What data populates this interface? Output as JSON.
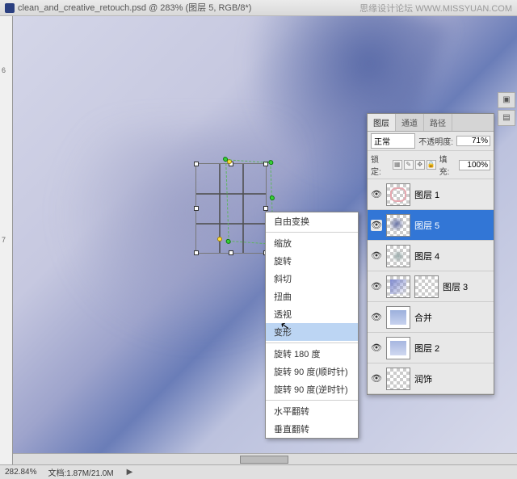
{
  "watermark": "思缘设计论坛   WWW.MISSYUAN.COM",
  "title": {
    "filename": "clean_and_creative_retouch.psd",
    "zoom": "283%",
    "layer_info": "(图层 5, RGB/8*)"
  },
  "ruler": {
    "mark6": "6",
    "mark7": "7"
  },
  "context_menu": {
    "free_transform": "自由变换",
    "scale": "缩放",
    "rotate": "旋转",
    "skew": "斜切",
    "distort": "扭曲",
    "perspective": "透视",
    "warp": "变形",
    "rotate180": "旋转 180 度",
    "rotate90cw": "旋转 90 度(顺时针)",
    "rotate90ccw": "旋转 90 度(逆时针)",
    "flip_h": "水平翻转",
    "flip_v": "垂直翻转"
  },
  "layers_panel": {
    "tab_layers": "图层",
    "tab_channels": "通道",
    "tab_paths": "路径",
    "blend_mode": "正常",
    "opacity_label": "不透明度:",
    "opacity_value": "71%",
    "lock_label": "锁定:",
    "fill_label": "填充:",
    "fill_value": "100%",
    "layers": [
      {
        "name": "图层 1",
        "selected": false,
        "thumb": "pink-outline"
      },
      {
        "name": "图层 5",
        "selected": true,
        "thumb": "blue-smudge"
      },
      {
        "name": "图层 4",
        "selected": false,
        "thumb": "gray-smudge"
      },
      {
        "name": "图层 3",
        "selected": false,
        "thumb": "curve-mask",
        "has_mask": true
      },
      {
        "name": "合并",
        "selected": false,
        "thumb": "face-blue"
      },
      {
        "name": "图层 2",
        "selected": false,
        "thumb": "face-blue2"
      },
      {
        "name": "润饰",
        "selected": false,
        "thumb": "checker"
      }
    ]
  },
  "status": {
    "zoom": "282.84%",
    "doc_label": "文档:",
    "doc_size": "1.87M/21.0M"
  }
}
